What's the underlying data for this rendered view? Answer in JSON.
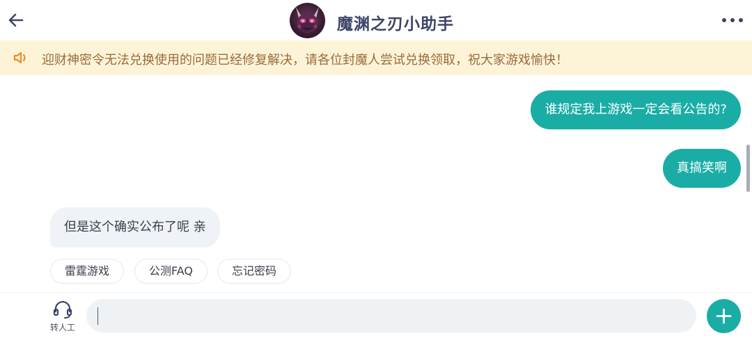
{
  "header": {
    "title": "魔渊之刃小助手",
    "back_icon": "arrow-left-icon",
    "more_icon": "more-horizontal-icon",
    "avatar_icon": "bot-avatar"
  },
  "notice": {
    "icon": "speaker-icon",
    "text": "迎财神密令无法兑换使用的问题已经修复解决，请各位封魔人尝试兑换领取，祝大家游戏愉快！"
  },
  "messages": [
    {
      "from": "user",
      "text": "谁规定我上游戏一定会看公告的?"
    },
    {
      "from": "user",
      "text": "真搞笑啊"
    },
    {
      "from": "assistant",
      "text": "但是这个确实公布了呢 亲"
    }
  ],
  "quick_replies": [
    "雷霆游戏",
    "公测FAQ",
    "忘记密码"
  ],
  "bottom": {
    "transfer_label": "转人工",
    "transfer_icon": "headset-icon",
    "input_value": "",
    "add_icon": "plus-icon"
  },
  "colors": {
    "accent": "#1aada6",
    "notice_bg": "#fdf4d8",
    "notice_text": "#9a6b3a",
    "title": "#3d4466"
  }
}
